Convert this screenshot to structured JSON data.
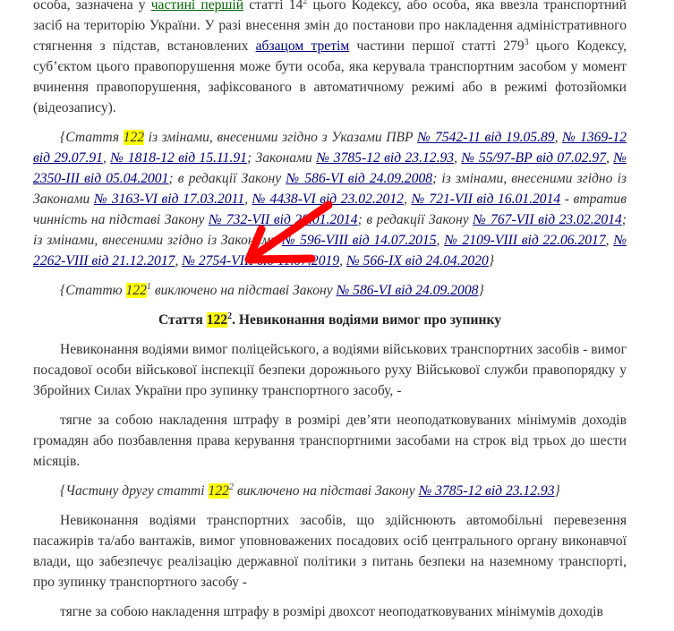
{
  "colors": {
    "link": "#000080",
    "link_green": "#006400",
    "highlight": "#ffff00",
    "annotation_arrow": "#ff0000"
  },
  "annotation": {
    "icon": "red-arrow-icon"
  },
  "paragraphs": [
    {
      "cls": "first",
      "segs": [
        {
          "t": "особа, зазначена у "
        },
        {
          "t": "частині першій",
          "link": "green"
        },
        {
          "t": " статті 14"
        },
        {
          "t": "2",
          "sup": true
        },
        {
          "t": " цього Кодексу, або особа, яка ввезла транспортний засіб на територію України. У разі внесення змін до постанови про накладення адміністративного стягнення з підстав, встановлених "
        },
        {
          "t": "абзацом третім",
          "link": "blue"
        },
        {
          "t": " частини першої статті 279"
        },
        {
          "t": "3",
          "sup": true
        },
        {
          "t": " цього Кодексу, суб’єктом цього правопорушення може бути особа, яка керувала транспортним засобом у момент вчинення правопорушення, зафіксованого в автоматичному режимі або в режимі фотозйомки (відеозапису)."
        }
      ]
    },
    {
      "cls": "note",
      "segs": [
        {
          "t": "{Стаття "
        },
        {
          "t": "122",
          "hl": true
        },
        {
          "t": " із змінами, внесеними згідно з Указами ПВР "
        },
        {
          "t": "№ 7542-11 від 19.05.89",
          "link": "blue"
        },
        {
          "t": ", "
        },
        {
          "t": "№ 1369-12 від 29.07.91",
          "link": "blue"
        },
        {
          "t": ", "
        },
        {
          "t": "№ 1818-12 від 15.11.91",
          "link": "blue"
        },
        {
          "t": "; Законами "
        },
        {
          "t": "№ 3785-12 від 23.12.93",
          "link": "blue"
        },
        {
          "t": ", "
        },
        {
          "t": "№ 55/97-ВР від 07.02.97",
          "link": "blue"
        },
        {
          "t": ", "
        },
        {
          "t": "№ 2350-III від 05.04.2001",
          "link": "blue"
        },
        {
          "t": "; в редакції Закону "
        },
        {
          "t": "№ 586-VI від 24.09.2008",
          "link": "blue"
        },
        {
          "t": "; із змінами, внесеними згідно із Законами "
        },
        {
          "t": "№ 3163-VI від 17.03.2011",
          "link": "blue"
        },
        {
          "t": ", "
        },
        {
          "t": "№ 4438-VI від 23.02.2012",
          "link": "blue"
        },
        {
          "t": ", "
        },
        {
          "t": "№ 721-VII від 16.01.2014",
          "link": "blue"
        },
        {
          "t": " - втратив чинність на підставі Закону "
        },
        {
          "t": "№ 732-VII від 28.01.2014",
          "link": "blue"
        },
        {
          "t": "; в редакції Закону "
        },
        {
          "t": "№ 767-VII від 23.02.2014",
          "link": "blue"
        },
        {
          "t": "; із змінами, внесеними згідно із Законами "
        },
        {
          "t": "№ 596-VIII від 14.07.2015",
          "link": "blue"
        },
        {
          "t": ", "
        },
        {
          "t": "№ 2109-VIII від 22.06.2017",
          "link": "blue"
        },
        {
          "t": ", "
        },
        {
          "t": "№ 2262-VIII від 21.12.2017",
          "link": "blue"
        },
        {
          "t": ", "
        },
        {
          "t": "№ 2754-VIII від 11.07.2019",
          "link": "blue"
        },
        {
          "t": ", "
        },
        {
          "t": "№ 566-IX від 24.04.2020",
          "link": "blue"
        },
        {
          "t": "}"
        }
      ]
    },
    {
      "cls": "note",
      "segs": [
        {
          "t": "{Статтю "
        },
        {
          "t": "122",
          "hl": true
        },
        {
          "t": "1",
          "sup": true
        },
        {
          "t": " виключено на підставі Закону "
        },
        {
          "t": "№ 586-VI від 24.09.2008",
          "link": "blue"
        },
        {
          "t": "}"
        }
      ]
    },
    {
      "cls": "heading",
      "segs": [
        {
          "t": "Стаття "
        },
        {
          "t": "122",
          "hl": true
        },
        {
          "t": "2",
          "sup": true
        },
        {
          "t": ". Невиконання водіями вимог про зупинку"
        }
      ]
    },
    {
      "cls": "",
      "segs": [
        {
          "t": "Невиконання водіями вимог поліцейського, а водіями військових транспортних засобів - вимог посадової особи військової інспекції безпеки дорожнього руху Військової служби правопорядку у Збройних Силах України про зупинку транспортного засобу, -"
        }
      ]
    },
    {
      "cls": "",
      "segs": [
        {
          "t": "тягне за собою накладення штрафу в розмірі дев’яти неоподатковуваних мінімумів доходів громадян або позбавлення права керування транспортними засобами на строк від трьох до шести місяців."
        }
      ]
    },
    {
      "cls": "note",
      "segs": [
        {
          "t": "{Частину другу статті "
        },
        {
          "t": "122",
          "hl": true
        },
        {
          "t": "2",
          "sup": true
        },
        {
          "t": " виключено на підставі Закону "
        },
        {
          "t": "№ 3785-12 від 23.12.93",
          "link": "blue"
        },
        {
          "t": "}"
        }
      ]
    },
    {
      "cls": "",
      "segs": [
        {
          "t": "Невиконання водіями транспортних засобів, що здійснюють автомобільні перевезення пасажирів та/або вантажів, вимог уповноважених посадових осіб центрального органу виконавчої влади, що забезпечує реалізацію державної політики з питань безпеки на наземному транспорті, про зупинку транспортного засобу -"
        }
      ]
    },
    {
      "cls": "",
      "segs": [
        {
          "t": "тягне за собою накладення штрафу в розмірі двохсот неоподатковуваних мінімумів доходів"
        }
      ]
    }
  ]
}
